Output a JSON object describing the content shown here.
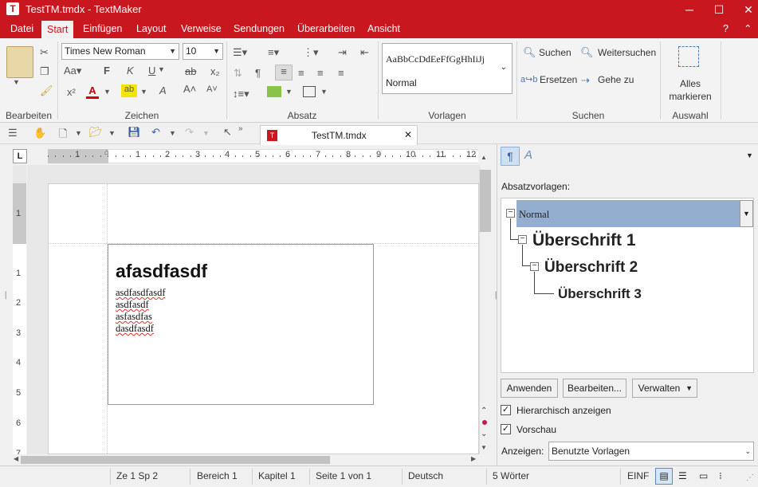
{
  "window": {
    "title": "TestTM.tmdx - TextMaker",
    "app_icon": "T",
    "minimize": "─",
    "maximize": "☐",
    "close": "✕"
  },
  "menu": {
    "items": [
      "Datei",
      "Start",
      "Einfügen",
      "Layout",
      "Verweise",
      "Sendungen",
      "Überarbeiten",
      "Ansicht"
    ],
    "help": "?",
    "collapse": "⌃"
  },
  "ribbon": {
    "groups": {
      "bearbeiten": "Bearbeiten",
      "zeichen": "Zeichen",
      "absatz": "Absatz",
      "vorlagen": "Vorlagen",
      "suchen": "Suchen",
      "auswahl": "Auswahl"
    },
    "font_name": "Times New Roman",
    "font_size": "10",
    "style_preview": "AaBbCcDdEeFfGgHhIiJj",
    "style_name": "Normal",
    "search": "Suchen",
    "search_next": "Weitersuchen",
    "replace": "Ersetzen",
    "goto": "Gehe zu",
    "select_all_line1": "Alles",
    "select_all_line2": "markieren",
    "bold": "F",
    "italic": "K",
    "underline": "U",
    "strike": "ab",
    "subscript": "x₂",
    "superscript": "x²"
  },
  "toolbar": {
    "doc_tab": "TestTM.tmdx",
    "tab_close": "✕"
  },
  "ruler": {
    "ticks": [
      "1",
      "1",
      "2",
      "3",
      "4",
      "5",
      "6",
      "7",
      "8",
      "9",
      "10",
      "11",
      "12"
    ],
    "vticks": [
      "1",
      "1",
      "2",
      "3",
      "4",
      "5",
      "6",
      "7"
    ]
  },
  "document": {
    "heading": "afasdfasdf",
    "lines": [
      "asdfasdfasdf",
      "asdfasdf",
      "asfasdfas",
      "dasdfasdf"
    ]
  },
  "sidepanel": {
    "label": "Absatzvorlagen:",
    "styles": [
      "Normal",
      "Überschrift 1",
      "Überschrift 2",
      "Überschrift 3"
    ],
    "apply": "Anwenden",
    "edit": "Bearbeiten...",
    "manage": "Verwalten",
    "hierarchical": "Hierarchisch anzeigen",
    "preview": "Vorschau",
    "show_label": "Anzeigen:",
    "show_value": "Benutzte Vorlagen"
  },
  "statusbar": {
    "position": "Ze 1 Sp 2",
    "area": "Bereich 1",
    "chapter": "Kapitel 1",
    "page": "Seite 1 von 1",
    "language": "Deutsch",
    "words": "5 Wörter",
    "mode": "EINF"
  }
}
